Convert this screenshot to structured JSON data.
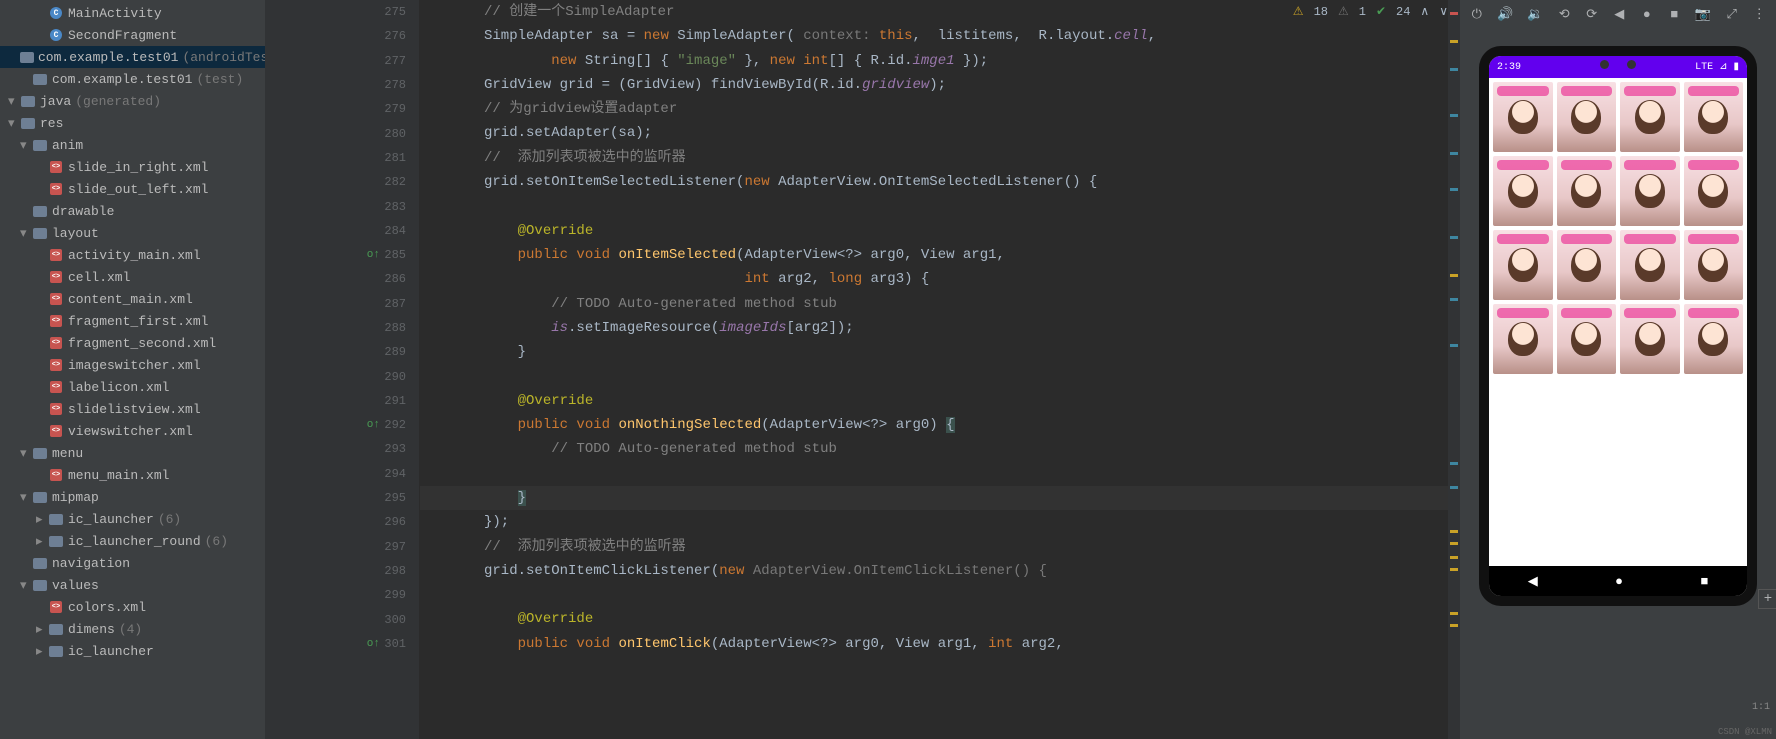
{
  "inspections": {
    "warn": "18",
    "weak": "1",
    "ok": "24"
  },
  "tree": [
    {
      "ind": 28,
      "icon": "class",
      "ilbl": "C",
      "lbl": "MainActivity"
    },
    {
      "ind": 28,
      "icon": "class",
      "ilbl": "C",
      "lbl": "SecondFragment"
    },
    {
      "ind": 12,
      "icon": "folder",
      "lbl": "com.example.test01",
      "note": "(androidTest)",
      "sel": true
    },
    {
      "ind": 12,
      "icon": "folder",
      "lbl": "com.example.test01",
      "note": "(test)"
    },
    {
      "ind": 0,
      "chev": "▾",
      "icon": "folder",
      "lbl": "java",
      "note": "(generated)"
    },
    {
      "ind": 0,
      "chev": "▾",
      "icon": "folder",
      "lbl": "res"
    },
    {
      "ind": 12,
      "chev": "▾",
      "icon": "folder",
      "lbl": "anim"
    },
    {
      "ind": 28,
      "icon": "file",
      "ilbl": "<>",
      "lbl": "slide_in_right.xml"
    },
    {
      "ind": 28,
      "icon": "file",
      "ilbl": "<>",
      "lbl": "slide_out_left.xml"
    },
    {
      "ind": 12,
      "icon": "folder",
      "lbl": "drawable"
    },
    {
      "ind": 12,
      "chev": "▾",
      "icon": "folder",
      "lbl": "layout"
    },
    {
      "ind": 28,
      "icon": "file",
      "ilbl": "<>",
      "lbl": "activity_main.xml"
    },
    {
      "ind": 28,
      "icon": "file",
      "ilbl": "<>",
      "lbl": "cell.xml"
    },
    {
      "ind": 28,
      "icon": "file",
      "ilbl": "<>",
      "lbl": "content_main.xml"
    },
    {
      "ind": 28,
      "icon": "file",
      "ilbl": "<>",
      "lbl": "fragment_first.xml"
    },
    {
      "ind": 28,
      "icon": "file",
      "ilbl": "<>",
      "lbl": "fragment_second.xml"
    },
    {
      "ind": 28,
      "icon": "file",
      "ilbl": "<>",
      "lbl": "imageswitcher.xml"
    },
    {
      "ind": 28,
      "icon": "file",
      "ilbl": "<>",
      "lbl": "labelicon.xml"
    },
    {
      "ind": 28,
      "icon": "file",
      "ilbl": "<>",
      "lbl": "slidelistview.xml"
    },
    {
      "ind": 28,
      "icon": "file",
      "ilbl": "<>",
      "lbl": "viewswitcher.xml"
    },
    {
      "ind": 12,
      "chev": "▾",
      "icon": "folder",
      "lbl": "menu"
    },
    {
      "ind": 28,
      "icon": "file",
      "ilbl": "<>",
      "lbl": "menu_main.xml"
    },
    {
      "ind": 12,
      "chev": "▾",
      "icon": "folder",
      "lbl": "mipmap"
    },
    {
      "ind": 28,
      "chev": "▸",
      "icon": "folder",
      "lbl": "ic_launcher",
      "note": "(6)"
    },
    {
      "ind": 28,
      "chev": "▸",
      "icon": "folder",
      "lbl": "ic_launcher_round",
      "note": "(6)"
    },
    {
      "ind": 12,
      "icon": "folder",
      "lbl": "navigation"
    },
    {
      "ind": 12,
      "chev": "▾",
      "icon": "folder",
      "lbl": "values"
    },
    {
      "ind": 28,
      "icon": "file",
      "ilbl": "<>",
      "lbl": "colors.xml"
    },
    {
      "ind": 28,
      "chev": "▸",
      "icon": "folder",
      "lbl": "dimens",
      "note": "(4)"
    },
    {
      "ind": 28,
      "chev": "▸",
      "icon": "folder",
      "lbl": "ic_launcher",
      "note": ""
    }
  ],
  "lines": [
    {
      "n": "275",
      "t": [
        {
          "c": "cmt",
          "s": "// 创建一个SimpleAdapter"
        }
      ]
    },
    {
      "n": "276",
      "t": [
        {
          "s": "SimpleAdapter sa = "
        },
        {
          "c": "kw",
          "s": "new "
        },
        {
          "s": "SimpleAdapter( "
        },
        {
          "c": "hint",
          "s": "context: "
        },
        {
          "c": "kw",
          "s": "this"
        },
        {
          "s": ",  listitems,  R.layout."
        },
        {
          "c": "fld",
          "s": "cell"
        },
        {
          "s": ","
        }
      ]
    },
    {
      "n": "277",
      "t": [
        {
          "s": "        "
        },
        {
          "c": "kw",
          "s": "new "
        },
        {
          "s": "String[] { "
        },
        {
          "c": "str",
          "s": "\"image\""
        },
        {
          "s": " }, "
        },
        {
          "c": "kw",
          "s": "new int"
        },
        {
          "s": "[] { R.id."
        },
        {
          "c": "fld",
          "s": "imge1"
        },
        {
          "s": " });"
        }
      ]
    },
    {
      "n": "278",
      "t": [
        {
          "s": "GridView grid = (GridView) findViewById(R.id."
        },
        {
          "c": "fld",
          "s": "gridview"
        },
        {
          "s": ");"
        }
      ]
    },
    {
      "n": "279",
      "t": [
        {
          "c": "cmt",
          "s": "// 为gridview设置adapter"
        }
      ]
    },
    {
      "n": "280",
      "t": [
        {
          "s": "grid.setAdapter(sa);"
        }
      ]
    },
    {
      "n": "281",
      "t": [
        {
          "c": "cmt",
          "s": "//  添加列表项被选中的监听器"
        }
      ]
    },
    {
      "n": "282",
      "t": [
        {
          "s": "grid.setOnItemSelectedListener("
        },
        {
          "c": "kw",
          "s": "new "
        },
        {
          "s": "AdapterView.OnItemSelectedListener() {"
        }
      ]
    },
    {
      "n": "283",
      "t": [
        {
          "s": ""
        }
      ]
    },
    {
      "n": "284",
      "t": [
        {
          "s": "    "
        },
        {
          "c": "ann",
          "s": "@Override"
        }
      ]
    },
    {
      "n": "285",
      "mark": "g",
      "t": [
        {
          "s": "    "
        },
        {
          "c": "kw",
          "s": "public void "
        },
        {
          "c": "fn",
          "s": "onItemSelected"
        },
        {
          "s": "(AdapterView<?> arg0, View arg1,"
        }
      ]
    },
    {
      "n": "286",
      "t": [
        {
          "s": "                               "
        },
        {
          "c": "kw",
          "s": "int "
        },
        {
          "s": "arg2, "
        },
        {
          "c": "kw",
          "s": "long "
        },
        {
          "s": "arg3) {"
        }
      ]
    },
    {
      "n": "287",
      "t": [
        {
          "s": "        "
        },
        {
          "c": "cmt",
          "s": "// TODO Auto-generated method stub"
        }
      ]
    },
    {
      "n": "288",
      "t": [
        {
          "s": "        "
        },
        {
          "c": "fld",
          "s": "is"
        },
        {
          "s": ".setImageResource("
        },
        {
          "c": "fld",
          "s": "imageIds"
        },
        {
          "s": "[arg2]);"
        }
      ]
    },
    {
      "n": "289",
      "t": [
        {
          "s": "    }"
        }
      ]
    },
    {
      "n": "290",
      "t": [
        {
          "s": ""
        }
      ]
    },
    {
      "n": "291",
      "t": [
        {
          "s": "    "
        },
        {
          "c": "ann",
          "s": "@Override"
        }
      ]
    },
    {
      "n": "292",
      "mark": "g",
      "t": [
        {
          "s": "    "
        },
        {
          "c": "kw",
          "s": "public void "
        },
        {
          "c": "fn",
          "s": "onNothingSelected"
        },
        {
          "s": "(AdapterView<?> arg0) "
        },
        {
          "c": "",
          "s": "{",
          "bg": "y"
        }
      ]
    },
    {
      "n": "293",
      "t": [
        {
          "s": "        "
        },
        {
          "c": "cmt",
          "s": "// TODO Auto-generated method stub"
        }
      ]
    },
    {
      "n": "294",
      "t": [
        {
          "s": ""
        }
      ]
    },
    {
      "n": "295",
      "hl": true,
      "t": [
        {
          "s": "    "
        },
        {
          "s": "}",
          "bg": "y"
        }
      ]
    },
    {
      "n": "296",
      "t": [
        {
          "s": "});"
        }
      ]
    },
    {
      "n": "297",
      "t": [
        {
          "c": "cmt",
          "s": "//  添加列表项被选中的监听器"
        }
      ]
    },
    {
      "n": "298",
      "t": [
        {
          "s": "grid.setOnItemClickListener("
        },
        {
          "c": "kw",
          "s": "new "
        },
        {
          "c": "hint",
          "s": "AdapterView.OnItemClickListener() {"
        }
      ]
    },
    {
      "n": "299",
      "t": [
        {
          "s": ""
        }
      ]
    },
    {
      "n": "300",
      "t": [
        {
          "s": "    "
        },
        {
          "c": "ann",
          "s": "@Override"
        }
      ]
    },
    {
      "n": "301",
      "mark": "g",
      "t": [
        {
          "s": "    "
        },
        {
          "c": "kw",
          "s": "public void "
        },
        {
          "c": "fn",
          "s": "onItemClick"
        },
        {
          "s": "(AdapterView<?> arg0, View arg1, "
        },
        {
          "c": "kw",
          "s": "int "
        },
        {
          "s": "arg2,"
        }
      ]
    }
  ],
  "emulator": {
    "time": "2:39",
    "signal": "LTE ⊿ ▮",
    "watermark": "CSDN @XLMN",
    "encoding": "1:1"
  },
  "stripe": [
    {
      "t": 12,
      "c": "#c75450"
    },
    {
      "t": 40,
      "c": "#c9a227"
    },
    {
      "t": 68,
      "c": "#3e86a0"
    },
    {
      "t": 114,
      "c": "#3e86a0"
    },
    {
      "t": 152,
      "c": "#3e86a0"
    },
    {
      "t": 188,
      "c": "#3e86a0"
    },
    {
      "t": 236,
      "c": "#3e86a0"
    },
    {
      "t": 274,
      "c": "#c9a227"
    },
    {
      "t": 298,
      "c": "#3e86a0"
    },
    {
      "t": 344,
      "c": "#3e86a0"
    },
    {
      "t": 462,
      "c": "#3e86a0"
    },
    {
      "t": 486,
      "c": "#3e86a0"
    },
    {
      "t": 530,
      "c": "#c9a227"
    },
    {
      "t": 542,
      "c": "#c9a227"
    },
    {
      "t": 556,
      "c": "#c9a227"
    },
    {
      "t": 568,
      "c": "#c9a227"
    },
    {
      "t": 612,
      "c": "#c9a227"
    },
    {
      "t": 624,
      "c": "#c9a227"
    }
  ]
}
